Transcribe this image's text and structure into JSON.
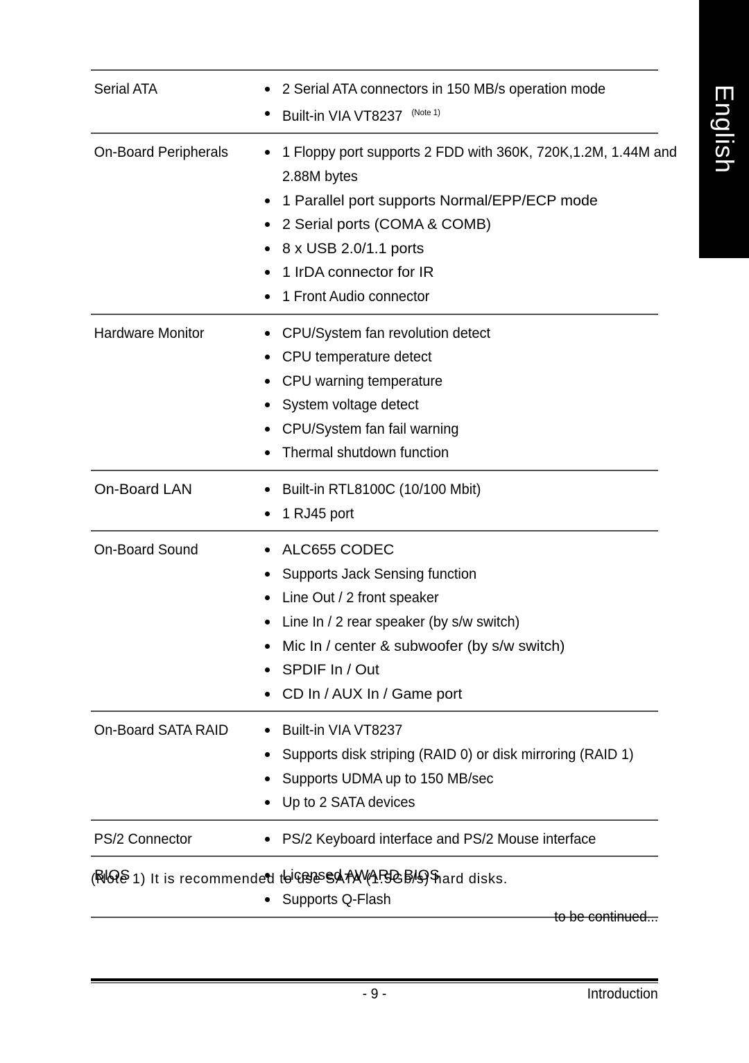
{
  "language_tab": {
    "label": "English"
  },
  "spec_table": {
    "rows": [
      {
        "label": "Serial ATA",
        "label_wide": false,
        "items": [
          {
            "text": "2 Serial ATA connectors in 150 MB/s operation mode",
            "wide": false
          },
          {
            "text": "Built-in VIA VT8237",
            "sup": "(Note 1)",
            "wide": false
          }
        ]
      },
      {
        "label": "On-Board Peripherals",
        "label_wide": false,
        "items": [
          {
            "text": "1 Floppy port supports 2 FDD with 360K, 720K,1.2M, 1.44M and",
            "cont": "2.88M bytes",
            "wide": false
          },
          {
            "text": "1 Parallel port supports Normal/EPP/ECP mode",
            "wide": true
          },
          {
            "text": "2 Serial ports (COMA & COMB)",
            "wide": true
          },
          {
            "text": "8 x USB 2.0/1.1 ports",
            "wide": true
          },
          {
            "text": "1 IrDA connector for IR",
            "wide": true
          },
          {
            "text": "1 Front Audio connector",
            "wide": false
          }
        ]
      },
      {
        "label": "Hardware Monitor",
        "label_wide": false,
        "items": [
          {
            "text": "CPU/System fan revolution detect",
            "wide": false
          },
          {
            "text": "CPU temperature detect",
            "wide": false
          },
          {
            "text": "CPU warning temperature",
            "wide": false
          },
          {
            "text": "System voltage detect",
            "wide": false
          },
          {
            "text": "CPU/System fan fail warning",
            "wide": false
          },
          {
            "text": "Thermal shutdown function",
            "wide": false
          }
        ]
      },
      {
        "label": "On-Board  LAN",
        "label_wide": true,
        "items": [
          {
            "text": "Built-in RTL8100C (10/100 Mbit)",
            "wide": false
          },
          {
            "text": "1  RJ45 port",
            "wide": false
          }
        ]
      },
      {
        "label": "On-Board Sound",
        "label_wide": false,
        "items": [
          {
            "text": "ALC655 CODEC",
            "wide": true
          },
          {
            "text": "Supports Jack Sensing function",
            "wide": false
          },
          {
            "text": "Line Out / 2 front speaker",
            "wide": false
          },
          {
            "text": "Line In / 2 rear speaker (by s/w switch)",
            "wide": false
          },
          {
            "text": "Mic In / center & subwoofer (by s/w switch)",
            "wide": true
          },
          {
            "text": "SPDIF In / Out",
            "wide": true
          },
          {
            "text": "CD In / AUX In / Game port",
            "wide": true
          }
        ]
      },
      {
        "label": "On-Board SATA RAID",
        "label_wide": false,
        "items": [
          {
            "text": "Built-in VIA VT8237",
            "wide": false
          },
          {
            "text": "Supports disk striping (RAID 0) or disk mirroring (RAID 1)",
            "wide": false
          },
          {
            "text": "Supports UDMA up to 150 MB/sec",
            "wide": false
          },
          {
            "text": "Up to 2 SATA devices",
            "wide": false
          }
        ]
      },
      {
        "label": "PS/2 Connector",
        "label_wide": false,
        "items": [
          {
            "text": "PS/2 Keyboard interface and PS/2 Mouse interface",
            "wide": false
          }
        ]
      },
      {
        "label": "BIOS",
        "label_wide": true,
        "items": [
          {
            "text": "Licensed AWARD BIOS",
            "wide": true
          },
          {
            "text": "Supports Q-Flash",
            "wide": false
          }
        ]
      }
    ]
  },
  "footnote": {
    "text": "(Note 1) It is recommended to use SATA (1.5Gb/s) hard disks."
  },
  "continued": {
    "text": "to be continued..."
  },
  "footer": {
    "page_number": "- 9 -",
    "chapter": "Introduction"
  }
}
